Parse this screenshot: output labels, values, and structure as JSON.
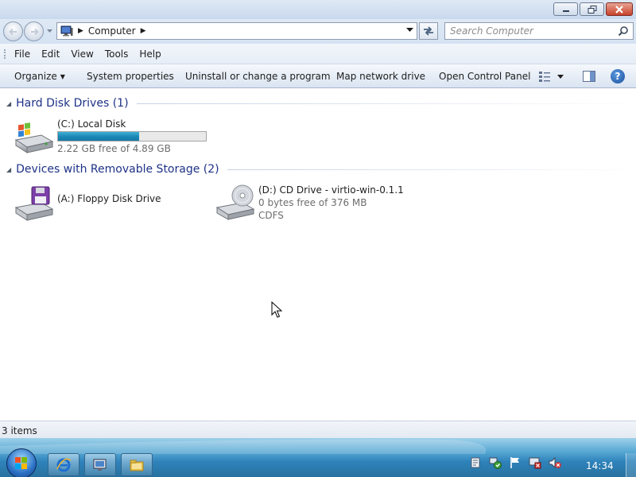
{
  "window": {
    "minimize_icon": "minimize-icon",
    "maximize_icon": "restore-icon",
    "close_icon": "close-icon"
  },
  "navigation": {
    "address_segments": [
      "Computer"
    ],
    "search_placeholder": "Search Computer"
  },
  "menu": {
    "items": [
      "File",
      "Edit",
      "View",
      "Tools",
      "Help"
    ]
  },
  "commands": {
    "organize": "Organize",
    "system_properties": "System properties",
    "uninstall": "Uninstall or change a program",
    "map_drive": "Map network drive",
    "control_panel": "Open Control Panel"
  },
  "groups": {
    "hard_disks": {
      "title": "Hard Disk Drives (1)",
      "drives": [
        {
          "name": "(C:) Local Disk",
          "free": "2.22 GB free of 4.89 GB",
          "used_fraction": 0.546,
          "bar_color": "#1b86b4"
        }
      ]
    },
    "removable": {
      "title": "Devices with Removable Storage (2)",
      "drives": [
        {
          "name": "(A:) Floppy Disk Drive"
        },
        {
          "name": "(D:) CD Drive - virtio-win-0.1.1",
          "free": "0 bytes free of 376 MB",
          "fs": "CDFS"
        }
      ]
    }
  },
  "status": {
    "items": "3 items"
  },
  "taskbar": {
    "clock": "14:34",
    "pinned": [
      "internet-explorer-icon",
      "remote-desktop-icon",
      "windows-explorer-icon"
    ],
    "tray": [
      "action-center-icon",
      "network-icon",
      "flag-icon",
      "display-icon",
      "volume-muted-icon"
    ]
  },
  "colors": {
    "accent": "#1e3287",
    "taskbar": "#2f83bb"
  }
}
